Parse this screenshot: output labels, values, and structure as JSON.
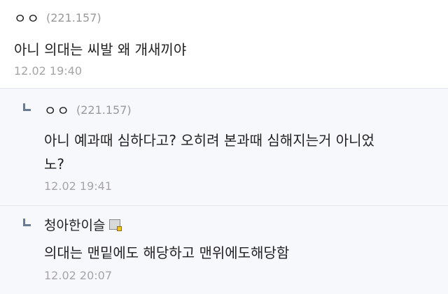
{
  "comments": [
    {
      "nickname": "ㅇㅇ",
      "ip": "(221.157)",
      "lines": [
        "아니 의대는 씨발 왜 개새끼야"
      ],
      "date": "12.02 19:40"
    }
  ],
  "replies": [
    {
      "nickname": "ㅇㅇ",
      "ip": "(221.157)",
      "lines": [
        "아니 예과때 심하다고? 오히려 본과때 심해지는거 아니었",
        "노?"
      ],
      "date": "12.02 19:41"
    },
    {
      "nickname": "청아한이슬",
      "badge_icon": "gallog-icon",
      "lines": [
        "의대는 맨밑에도 해당하고 맨위에도해당함"
      ],
      "date": "12.02 20:07"
    }
  ]
}
